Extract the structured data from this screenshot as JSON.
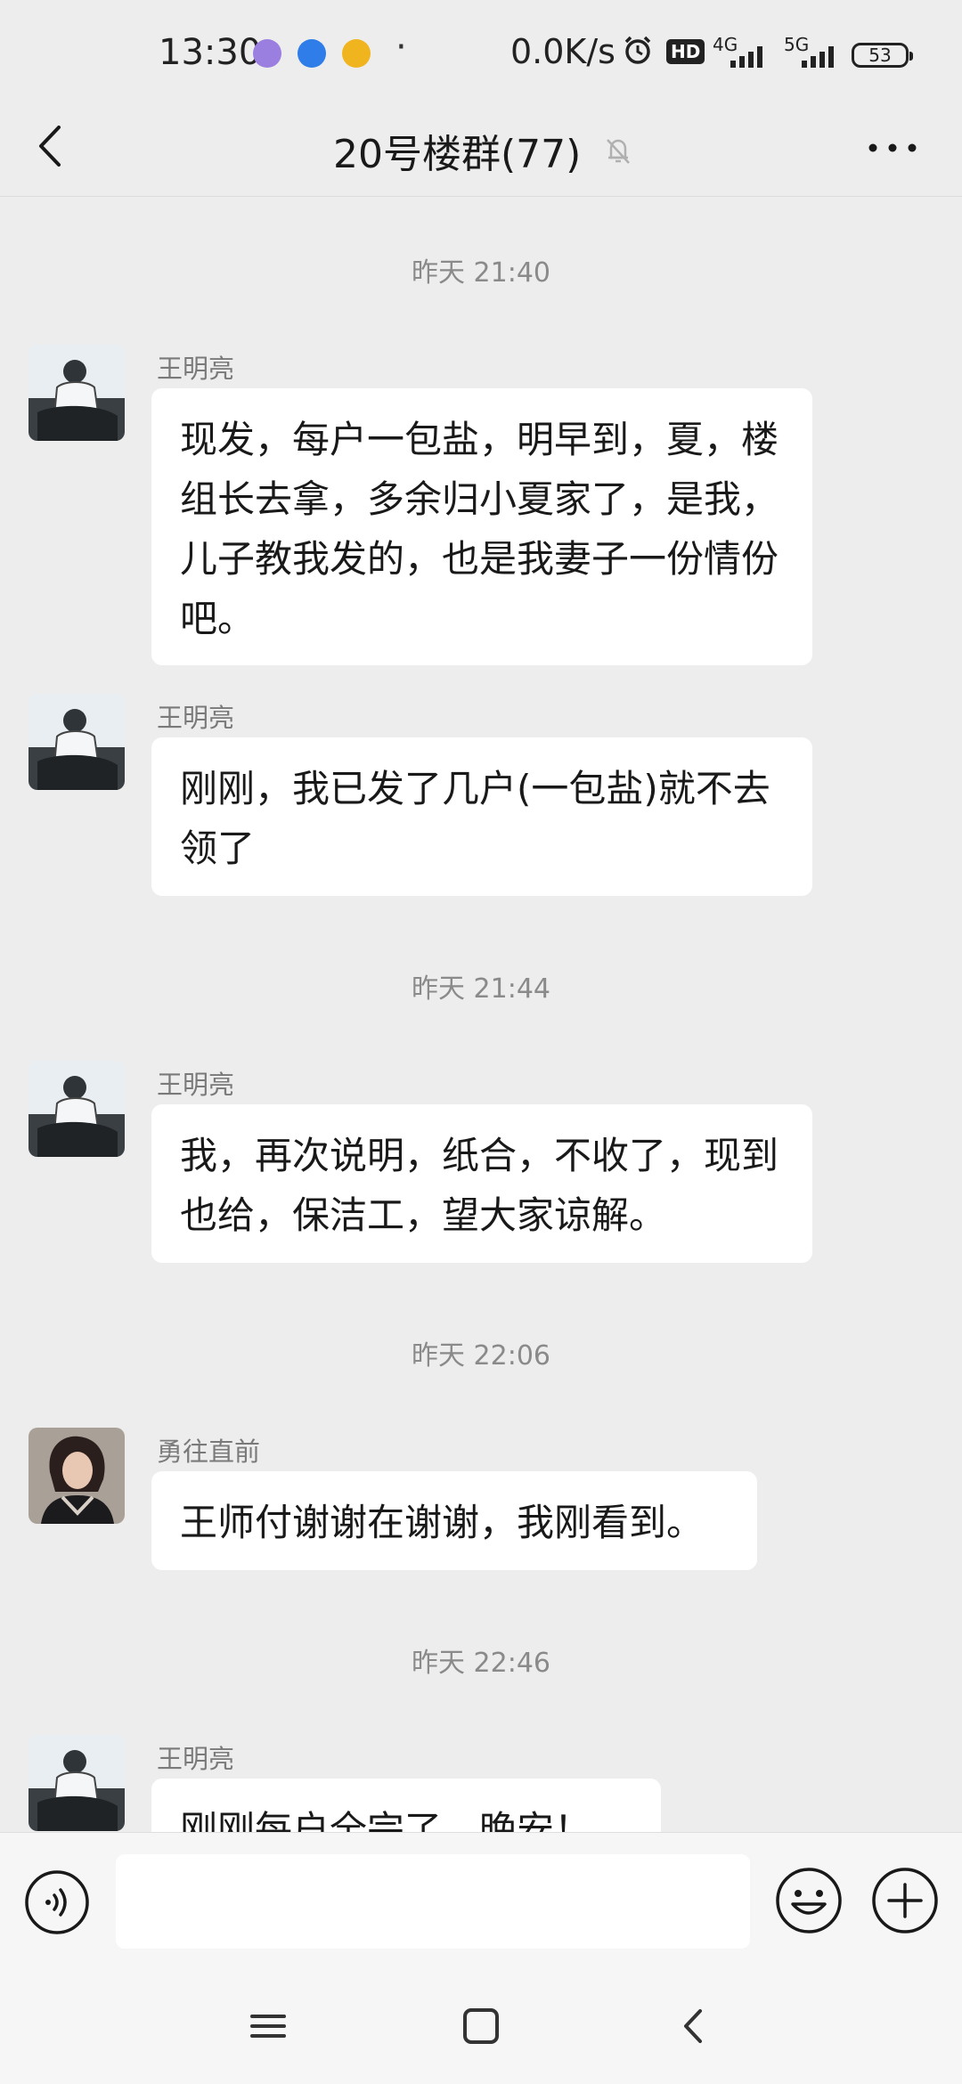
{
  "status_bar": {
    "time": "13:30",
    "dot": "·",
    "net_speed": "0.0K/s",
    "hd_label": "HD",
    "net1": "4G",
    "net2": "5G",
    "battery": "53"
  },
  "header": {
    "title": "20号楼群(77)"
  },
  "messages": [
    {
      "type": "time",
      "text": "昨天 21:40"
    },
    {
      "type": "msg",
      "sender": "王明亮",
      "text": "现发，每户一包盐，明早到，夏，楼组长去拿，多余归小夏家了，是我，儿子教我发的，也是我妻子一份情份吧。"
    },
    {
      "type": "msg",
      "sender": "王明亮",
      "text": "刚刚，我已发了几户(一包盐)就不去领了"
    },
    {
      "type": "time",
      "text": "昨天 21:44"
    },
    {
      "type": "msg",
      "sender": "王明亮",
      "text": "我，再次说明，纸合，不收了，现到也给，保洁工，望大家谅解。"
    },
    {
      "type": "time",
      "text": "昨天 22:06"
    },
    {
      "type": "msg",
      "sender": "勇往直前",
      "text": "王师付谢谢在谢谢，我刚看到。"
    },
    {
      "type": "time",
      "text": "昨天 22:46"
    },
    {
      "type": "msg",
      "sender": "王明亮",
      "text": "刚刚每户全完了，晚安！"
    }
  ],
  "input": {
    "value": ""
  },
  "colors": {
    "background": "#ededed",
    "bubble": "#ffffff",
    "meta_text": "#8a8a8a"
  }
}
